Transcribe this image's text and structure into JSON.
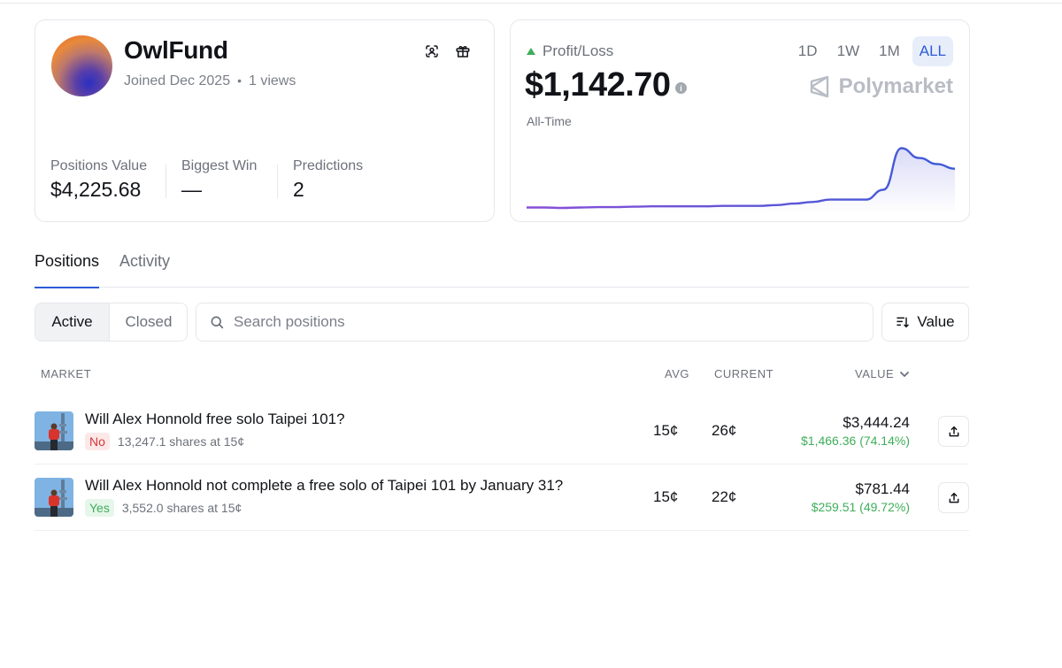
{
  "profile": {
    "username": "OwlFund",
    "joined": "Joined Dec 2025",
    "views": "1 views",
    "icons": [
      "scan-profile-icon",
      "gift-icon"
    ],
    "stats": [
      {
        "label": "Positions Value",
        "value": "$4,225.68"
      },
      {
        "label": "Biggest Win",
        "value": "—"
      },
      {
        "label": "Predictions",
        "value": "2"
      }
    ]
  },
  "pnl": {
    "label": "Profit/Loss",
    "value": "$1,142.70",
    "period_label": "All-Time",
    "brand": "Polymarket",
    "ranges": [
      "1D",
      "1W",
      "1M",
      "ALL"
    ],
    "active_range": "ALL",
    "trend_color": "#3fae5a",
    "line_color_start": "#8a4fd8",
    "line_color_end": "#3b5bd6"
  },
  "chart_data": {
    "type": "area",
    "title": "",
    "xlabel": "",
    "ylabel": "",
    "x": [
      0,
      1,
      2,
      3,
      4,
      5,
      6,
      7,
      8,
      9,
      10,
      11,
      12,
      13,
      14,
      15,
      16,
      17,
      18,
      19,
      20,
      21,
      22,
      23,
      24
    ],
    "values": [
      100,
      100,
      99,
      100,
      101,
      101,
      102,
      103,
      103,
      103,
      103,
      104,
      104,
      104,
      106,
      110,
      114,
      120,
      120,
      120,
      145,
      250,
      225,
      210,
      198
    ],
    "ylim": [
      90,
      260
    ],
    "grid": false
  },
  "tabs": [
    {
      "label": "Positions",
      "active": true
    },
    {
      "label": "Activity",
      "active": false
    }
  ],
  "filters": {
    "active_label": "Active",
    "closed_label": "Closed",
    "search_placeholder": "Search positions",
    "sort_label": "Value"
  },
  "table": {
    "headers": {
      "market": "MARKET",
      "avg": "AVG",
      "current": "CURRENT",
      "value": "VALUE"
    },
    "rows": [
      {
        "question": "Will Alex Honnold free solo Taipei 101?",
        "outcome": "No",
        "shares": "13,247.1 shares at 15¢",
        "avg": "15¢",
        "current": "26¢",
        "value": "$3,444.24",
        "pnl": "$1,466.36 (74.14%)"
      },
      {
        "question": "Will Alex Honnold not complete a free solo of Taipei 101 by January 31?",
        "outcome": "Yes",
        "shares": "3,552.0 shares at 15¢",
        "avg": "15¢",
        "current": "22¢",
        "value": "$781.44",
        "pnl": "$259.51 (49.72%)"
      }
    ]
  }
}
